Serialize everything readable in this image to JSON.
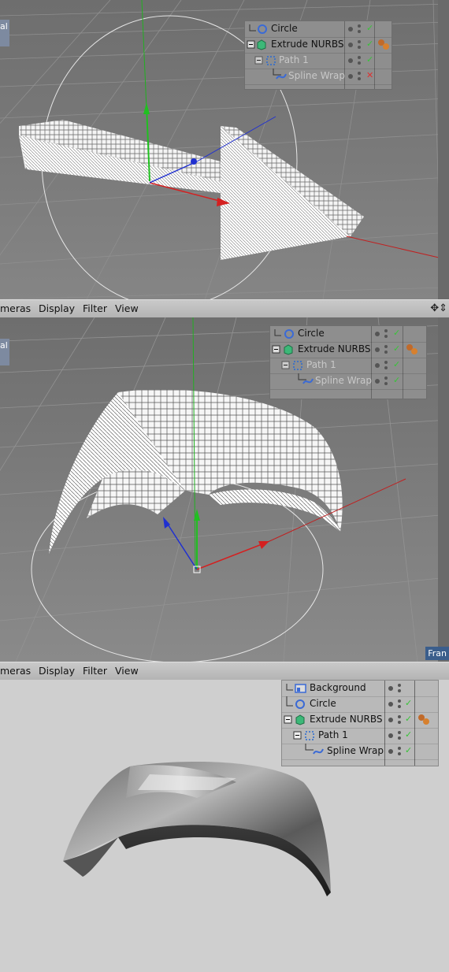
{
  "panel1": {
    "corner_label": "al",
    "object_manager": {
      "rows": [
        {
          "name": "Circle",
          "icon": "circle-icon",
          "status": "check",
          "dimmed": false
        },
        {
          "name": "Extrude NURBS",
          "icon": "extrude-nurbs-icon",
          "status": "check",
          "dimmed": false,
          "tag": "material-tag"
        },
        {
          "name": "Path 1",
          "icon": "path-icon",
          "status": "check",
          "dimmed": true
        },
        {
          "name": "Spline Wrap",
          "icon": "spline-wrap-icon",
          "status": "cross",
          "dimmed": true
        }
      ]
    }
  },
  "menubar1": {
    "items": [
      "meras",
      "Display",
      "Filter",
      "View"
    ]
  },
  "panel2": {
    "corner_label": "al",
    "frame_label": "Fran",
    "object_manager": {
      "rows": [
        {
          "name": "Circle",
          "icon": "circle-icon",
          "status": "check"
        },
        {
          "name": "Extrude NURBS",
          "icon": "extrude-nurbs-icon",
          "status": "check",
          "tag": "material-tag"
        },
        {
          "name": "Path 1",
          "icon": "path-icon",
          "status": "check"
        },
        {
          "name": "Spline Wrap",
          "icon": "spline-wrap-icon",
          "status": "check"
        }
      ]
    }
  },
  "menubar2": {
    "items": [
      "meras",
      "Display",
      "Filter",
      "View"
    ]
  },
  "panel3": {
    "object_manager": {
      "rows": [
        {
          "name": "Background",
          "icon": "background-icon",
          "status": "none"
        },
        {
          "name": "Circle",
          "icon": "circle-icon",
          "status": "check"
        },
        {
          "name": "Extrude NURBS",
          "icon": "extrude-nurbs-icon",
          "status": "check",
          "tag": "material-tag"
        },
        {
          "name": "Path 1",
          "icon": "path-icon",
          "status": "check"
        },
        {
          "name": "Spline Wrap",
          "icon": "spline-wrap-icon",
          "status": "check"
        }
      ]
    }
  },
  "colors": {
    "viewport_bg": "#7c7c7c",
    "render_bg": "#cfcfcf",
    "axis_x": "#d42020",
    "axis_y": "#20b020",
    "axis_z": "#2030d0",
    "check": "#38c438",
    "cross": "#e03030"
  }
}
